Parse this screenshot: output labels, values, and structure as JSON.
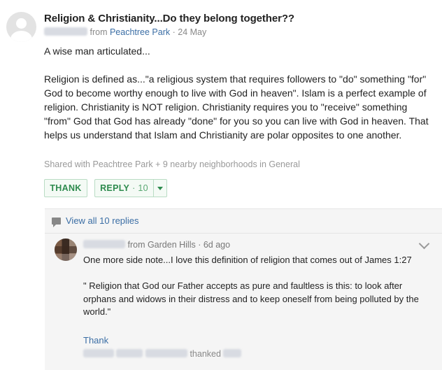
{
  "post": {
    "title": "Religion & Christianity...Do they belong together??",
    "from_text": "from",
    "neighborhood": "Peachtree Park",
    "date": "· 24 May",
    "body": [
      "A wise man articulated...",
      "Religion is defined as...\"a religious system that requires followers to \"do\" something \"for\" God to become worthy enough to live with God in heaven\". Islam is a perfect example of religion. Christianity is NOT religion. Christianity requires you to \"receive\" something \"from\" God that God has already \"done\" for you so you can live with God in heaven. That helps us understand that Islam and Christianity are polar opposites to one another."
    ],
    "shared": "Shared with Peachtree Park + 9 nearby neighborhoods in General"
  },
  "actions": {
    "thank_label": "THANK",
    "reply_label": "REPLY",
    "reply_count": "· 10"
  },
  "replies": {
    "view_all": "View all 10 replies",
    "reply": {
      "meta": "from Garden Hills · 6d ago",
      "body": [
        "One more side note...I love this definition of religion that comes out of James 1:27",
        "\" Religion that God our Father accepts as pure and faultless is this: to look after orphans and widows in their distress and to keep oneself from being polluted by the world.\""
      ],
      "thank_label": "Thank",
      "thanked_text": "thanked"
    }
  },
  "colors": {
    "link": "#3b6ea5",
    "accent_green": "#2e8b4e"
  },
  "icons": [
    "user-avatar-icon",
    "comment-icon",
    "chevron-down-icon"
  ]
}
